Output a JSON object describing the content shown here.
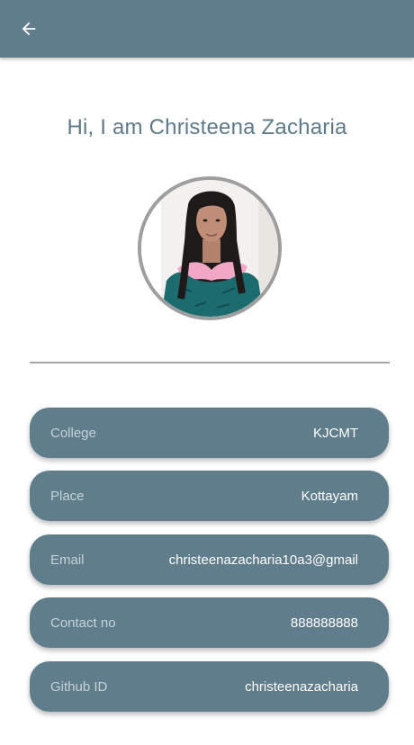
{
  "app_bar": {
    "back_icon": "arrow-left-icon",
    "background": "#607d8b"
  },
  "profile": {
    "greeting": "Hi, I am Christeena Zacharia",
    "photo_alt": "profile photo"
  },
  "fields": [
    {
      "label": "College",
      "value": "KJCMT"
    },
    {
      "label": "Place",
      "value": "Kottayam"
    },
    {
      "label": "Email",
      "value": "christeenazacharia10a3@gmail"
    },
    {
      "label": "Contact no",
      "value": "888888888"
    },
    {
      "label": "Github ID",
      "value": "christeenazacharia"
    }
  ],
  "colors": {
    "accent": "#607d8b",
    "greeting_text": "#5e7a89",
    "avatar_border": "#9e9e9e"
  }
}
